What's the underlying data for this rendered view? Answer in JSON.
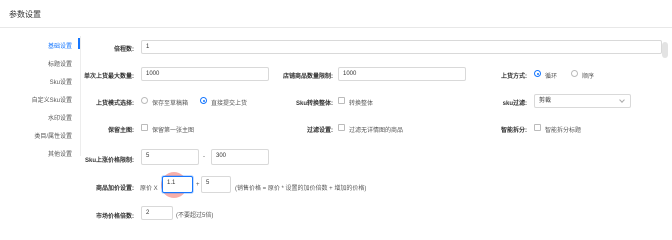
{
  "title": "参数设置",
  "sidebar": {
    "items": [
      {
        "label": "基础设置",
        "active": true
      },
      {
        "label": "标题设置"
      },
      {
        "label": "Sku设置"
      },
      {
        "label": "自定义Sku设置"
      },
      {
        "label": "水印设置"
      },
      {
        "label": "类目/属性设置"
      },
      {
        "label": "其他设置"
      }
    ]
  },
  "form": {
    "multiplier": {
      "label": "倍程数:",
      "value": "1"
    },
    "single_upload": {
      "label": "单次上货最大数量:",
      "value": "1000"
    },
    "store_limit": {
      "label": "店铺商品数量限制:",
      "value": "1000"
    },
    "upload_method": {
      "label": "上货方式:",
      "options": [
        "循环",
        "顺序"
      ],
      "selected": 0
    },
    "upload_mode": {
      "label": "上货模式选择:",
      "options": [
        "保存至草稿箱",
        "直接提交上货"
      ],
      "selected": 1
    },
    "sku_convert": {
      "label": "Sku转换整体:",
      "option": "转换整体"
    },
    "sku_filter": {
      "label": "sku过滤:",
      "value": "剪裁"
    },
    "keep_main": {
      "label": "保留主图:",
      "option": "保留第一张主图"
    },
    "filter_setting": {
      "label": "过滤设置:",
      "option": "过滤无详情图的商品"
    },
    "smart_split": {
      "label": "智能拆分:",
      "option": "智能拆分标题"
    },
    "sku_price_limit": {
      "label": "Sku上涨价格限制:",
      "min": "5",
      "sep": "-",
      "max": "300"
    },
    "price_setting": {
      "label": "商品加价设置:",
      "prefix": "原价 X",
      "factor": "1.1",
      "plus": "+",
      "add": "5",
      "hint": "(销售价格 = 原价 * 设置的加价倍数 + 增加的价格)"
    },
    "market_price": {
      "label": "市场价格倍数:",
      "value": "2",
      "hint": "(不要超过5倍)"
    }
  },
  "colors": {
    "accent": "#1677ff",
    "highlight": "#f06e64"
  }
}
